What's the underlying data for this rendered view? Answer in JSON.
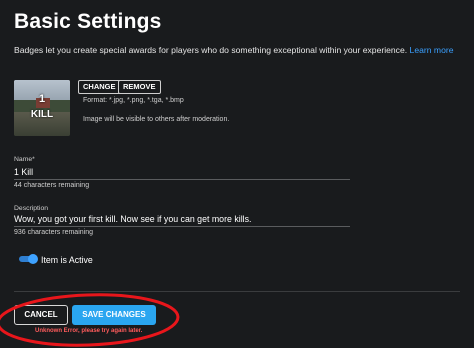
{
  "page": {
    "title": "Basic Settings",
    "description": "Badges let you create special awards for players who do something exceptional within your experience.",
    "learn_more": "Learn more"
  },
  "image": {
    "thumb_line1": "1",
    "thumb_line2": "KILL",
    "change_label": "CHANGE",
    "remove_label": "REMOVE",
    "format_note": "Format: *.jpg, *.png, *.tga, *.bmp",
    "moderation_note": "Image will be visible to others after moderation."
  },
  "name_field": {
    "label": "Name*",
    "value": "1 Kill",
    "remaining": "44 characters remaining"
  },
  "description_field": {
    "label": "Description",
    "value": "Wow, you got your first kill. Now see if you can get more kills.",
    "remaining": "936 characters remaining"
  },
  "active_toggle": {
    "label": "Item is Active",
    "on": true
  },
  "actions": {
    "cancel_label": "CANCEL",
    "save_label": "SAVE CHANGES",
    "error_text": "Unknown Error, please try again later."
  },
  "colors": {
    "accent": "#2aa6f0",
    "error": "#ff5c5c",
    "annotation": "#e8161b"
  }
}
